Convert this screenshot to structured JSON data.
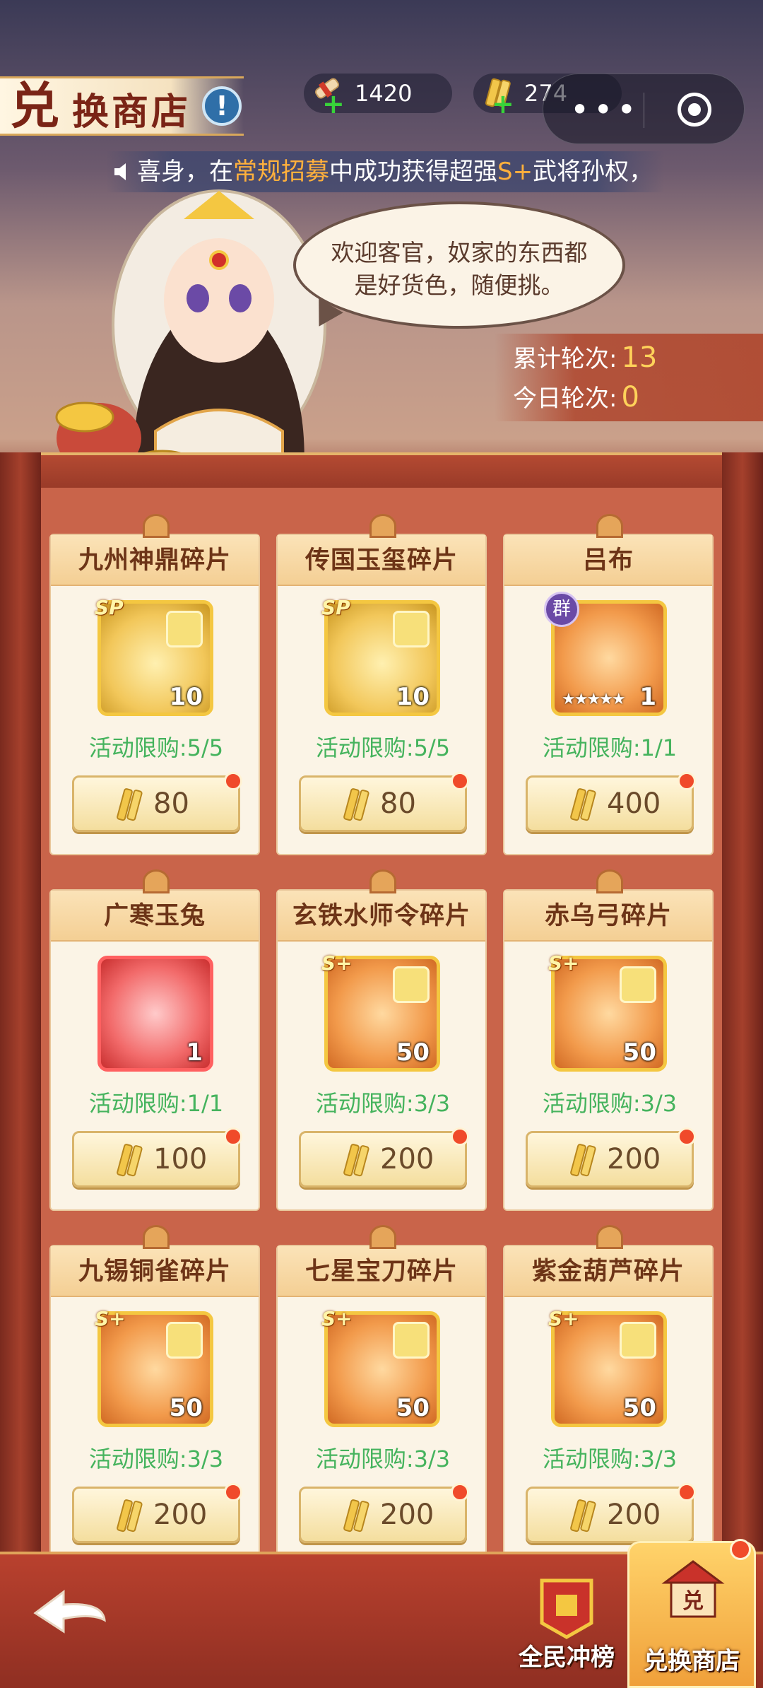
{
  "header": {
    "title_first_char": "兑",
    "title_rest": "换商店",
    "info_icon": "exclamation-icon",
    "resources": [
      {
        "value": "1420",
        "icon": "scroll-ticket-icon"
      },
      {
        "value": "274",
        "icon": "gold-token-icon"
      }
    ],
    "more_label": "•••"
  },
  "marquee": {
    "prefix": "喜身，在",
    "highlight1": "常规招募",
    "middle": "中成功获得超强",
    "highlight2": "S+",
    "suffix": "武将孙权，"
  },
  "speech": {
    "text": "欢迎客官，奴家的东西都是好货色，随便挑。"
  },
  "rounds": {
    "total_label": "累计轮次:",
    "total_value": "13",
    "today_label": "今日轮次:",
    "today_value": "0"
  },
  "items": [
    {
      "name": "九州神鼎碎片",
      "tag": "SP",
      "count": "10",
      "limit": "活动限购:5/5",
      "price": "80",
      "style": "gold"
    },
    {
      "name": "传国玉玺碎片",
      "tag": "SP",
      "count": "10",
      "limit": "活动限购:5/5",
      "price": "80",
      "style": "gold"
    },
    {
      "name": "吕布",
      "tag": "群",
      "count": "1",
      "limit": "活动限购:1/1",
      "price": "400",
      "style": "orange"
    },
    {
      "name": "广寒玉兔",
      "tag": "",
      "count": "1",
      "limit": "活动限购:1/1",
      "price": "100",
      "style": "red"
    },
    {
      "name": "玄铁水师令碎片",
      "tag": "S+",
      "count": "50",
      "limit": "活动限购:3/3",
      "price": "200",
      "style": "orange"
    },
    {
      "name": "赤乌弓碎片",
      "tag": "S+",
      "count": "50",
      "limit": "活动限购:3/3",
      "price": "200",
      "style": "orange"
    },
    {
      "name": "九锡铜雀碎片",
      "tag": "S+",
      "count": "50",
      "limit": "活动限购:3/3",
      "price": "200",
      "style": "orange"
    },
    {
      "name": "七星宝刀碎片",
      "tag": "S+",
      "count": "50",
      "limit": "活动限购:3/3",
      "price": "200",
      "style": "orange"
    },
    {
      "name": "紫金葫芦碎片",
      "tag": "S+",
      "count": "50",
      "limit": "活动限购:3/3",
      "price": "200",
      "style": "orange"
    }
  ],
  "bottom": {
    "rank_label": "全民冲榜",
    "shop_label": "兑换商店",
    "shop_icon_text": "兑"
  }
}
